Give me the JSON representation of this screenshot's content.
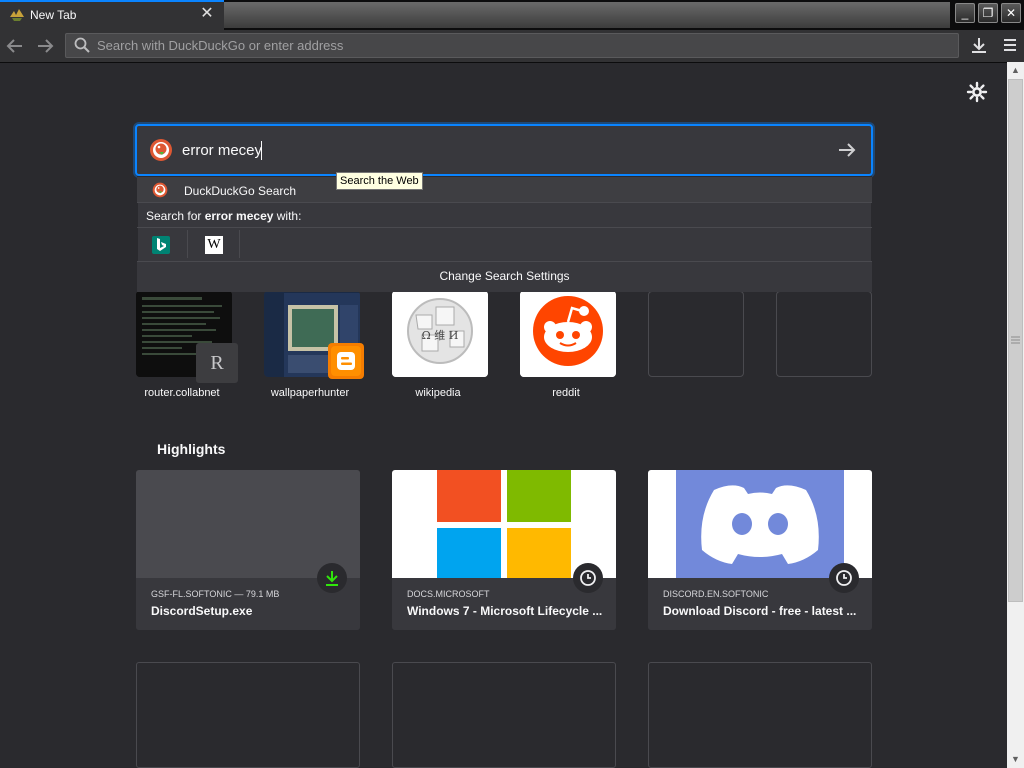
{
  "tab": {
    "title": "New Tab",
    "close": "✕"
  },
  "window": {
    "minimize": "_",
    "maximize": "❐",
    "close": "✕"
  },
  "urlbar": {
    "placeholder": "Search with DuckDuckGo or enter address"
  },
  "search": {
    "query": "error mecey",
    "engine_row_label": "DuckDuckGo Search",
    "tooltip": "Search the Web",
    "search_for_prefix": "Search for ",
    "search_for_query": "error mecey",
    "search_for_suffix": " with:",
    "engines": [
      "bing-icon",
      "wikipedia-icon"
    ],
    "wiki_letter": "W",
    "change_settings": "Change Search Settings"
  },
  "top_sites": [
    {
      "label": "router.collabnet",
      "badge": "R"
    },
    {
      "label": "wallpaperhunter"
    },
    {
      "label": "wikipedia",
      "glyphs": "Ω 维 И"
    },
    {
      "label": "reddit"
    },
    {
      "label": ""
    },
    {
      "label": ""
    }
  ],
  "highlights": {
    "title": "Highlights",
    "cards": [
      {
        "source": "GSF-FL.SOFTONIC — 79.1 MB",
        "title": "DiscordSetup.exe",
        "badge_icon": "download-icon"
      },
      {
        "source": "DOCS.MICROSOFT",
        "title": "Windows 7 - Microsoft Lifecycle ...",
        "badge_icon": "clock-icon"
      },
      {
        "source": "DISCORD.EN.SOFTONIC",
        "title": "Download Discord - free - latest ...",
        "badge_icon": "clock-icon"
      }
    ]
  },
  "colors": {
    "background": "#2a2a2e",
    "accent": "#0a84ff",
    "card": "#38383d",
    "download_green": "#30e60b",
    "reddit": "#ff4500",
    "blogger": "#f57d00",
    "discord": "#7289da"
  }
}
